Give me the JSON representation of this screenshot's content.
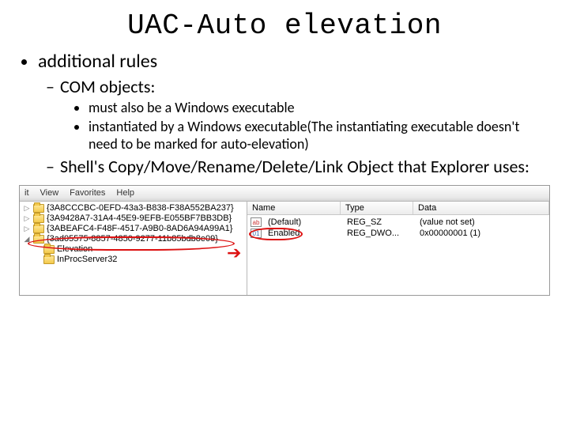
{
  "title": "UAC-Auto elevation",
  "bullets": {
    "l1_0": "additional rules",
    "l2_0": "COM objects:",
    "l3_0": "must also be a Windows executable",
    "l3_1": "instantiated by a Windows executable(The instantiating executable doesn't need to be marked for auto-elevation)",
    "l2_1": "Shell's Copy/Move/Rename/Delete/Link Object that Explorer uses:"
  },
  "regedit": {
    "menu": {
      "m0": "it",
      "m1": "View",
      "m2": "Favorites",
      "m3": "Help"
    },
    "tree": {
      "items": [
        {
          "exp": "▷",
          "label": "{3A8CCCBC-0EFD-43a3-B838-F38A552BA237}"
        },
        {
          "exp": "▷",
          "label": "{3A9428A7-31A4-45E9-9EFB-E055BF7BB3DB}"
        },
        {
          "exp": "▷",
          "label": "{3ABEAFC4-F48F-4517-A9B0-8AD6A94A99A1}"
        },
        {
          "exp": "◢",
          "label": "{3ad05575-8857-4850-9277-11b85bdb8e09}"
        }
      ],
      "children": [
        {
          "label": "Elevation"
        },
        {
          "label": "InProcServer32"
        }
      ]
    },
    "values": {
      "headers": {
        "name": "Name",
        "type": "Type",
        "data": "Data"
      },
      "rows": [
        {
          "icon": "ab",
          "kind": "str",
          "name": "(Default)",
          "type": "REG_SZ",
          "data": "(value not set)"
        },
        {
          "icon": "01",
          "kind": "dw",
          "name": "Enabled",
          "type": "REG_DWO...",
          "data": "0x00000001 (1)"
        }
      ]
    }
  }
}
